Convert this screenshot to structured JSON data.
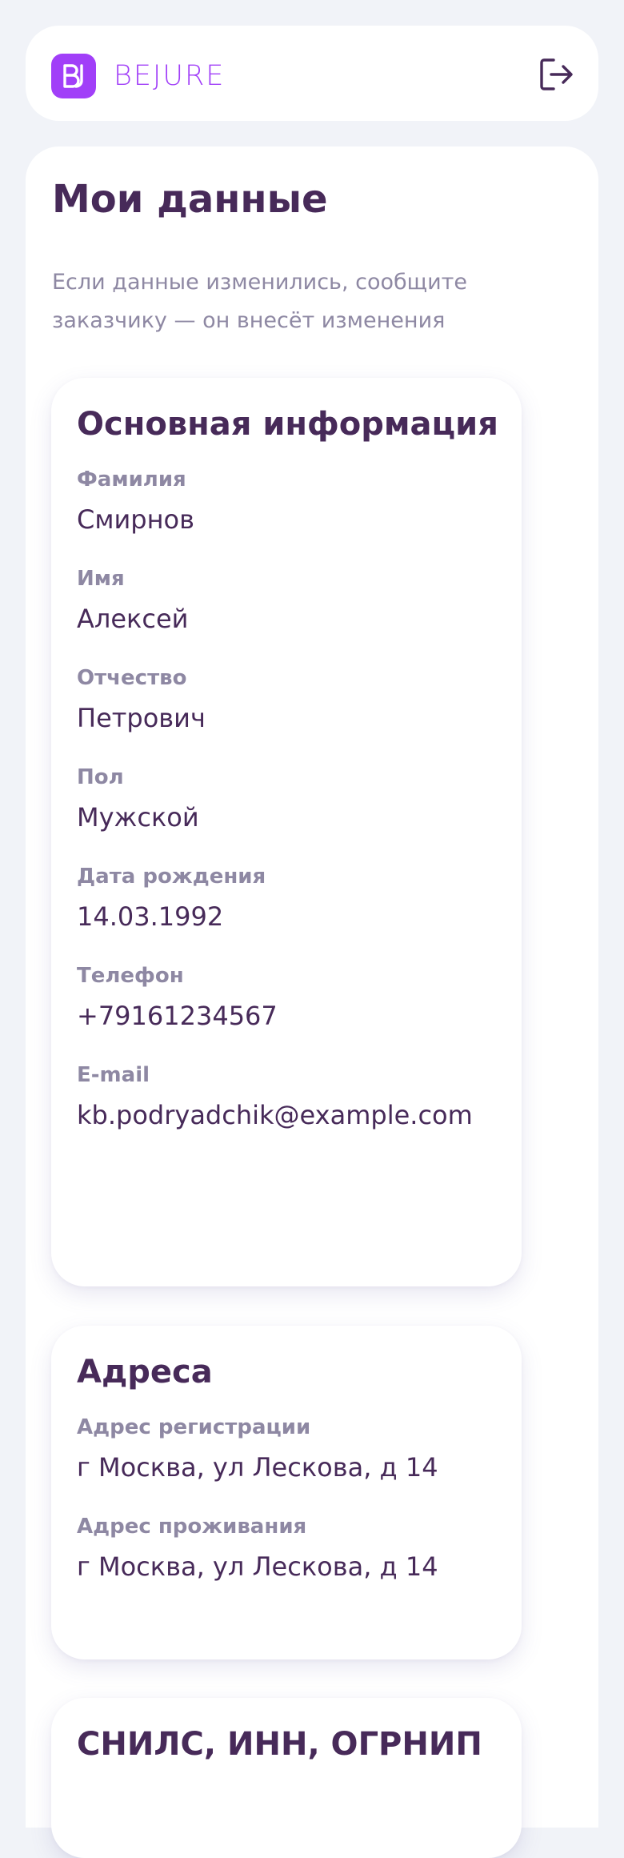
{
  "header": {
    "logo_text": "BEJURE",
    "logo_icon": "bj-logo-icon",
    "logout_icon": "logout-icon"
  },
  "main": {
    "title": "Мои данные",
    "subtitle": "Если данные изменились, сообщите заказчику — он внесёт изменения"
  },
  "cards": {
    "basic": {
      "title": "Основная информация",
      "fields": [
        {
          "label": "Фамилия",
          "value": "Смирнов"
        },
        {
          "label": "Имя",
          "value": "Алексей"
        },
        {
          "label": "Отчество",
          "value": "Петрович"
        },
        {
          "label": "Пол",
          "value": "Мужской"
        },
        {
          "label": "Дата рождения",
          "value": "14.03.1992"
        },
        {
          "label": "Телефон",
          "value": "+79161234567"
        },
        {
          "label": "E-mail",
          "value": "kb.podryadchik@example.com"
        }
      ]
    },
    "addresses": {
      "title": "Адреса",
      "fields": [
        {
          "label": "Адрес регистрации",
          "value": "г Москва, ул Лескова, д 14"
        },
        {
          "label": "Адрес проживания",
          "value": "г Москва, ул Лескова, д 14"
        }
      ]
    },
    "ids": {
      "title": "СНИЛС, ИНН, ОГРНИП"
    }
  },
  "colors": {
    "page_background": "#f1f3f8",
    "brand": "#a13ff8",
    "text_primary": "#472a59",
    "text_secondary": "#8e88a3"
  }
}
